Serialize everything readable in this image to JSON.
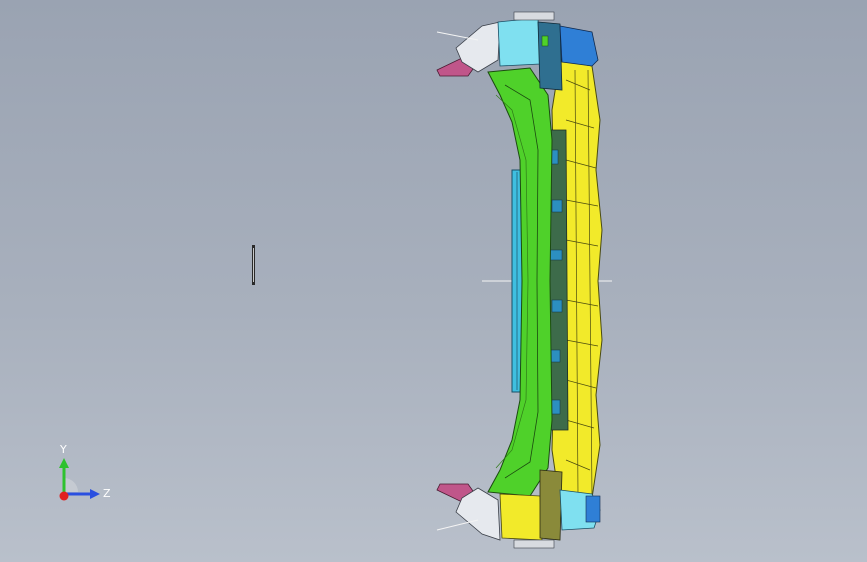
{
  "triad": {
    "y_label": "Y",
    "z_label": "Z",
    "colors": {
      "y": "#2ec22e",
      "z": "#2a4fe0",
      "x": "#e02020"
    }
  },
  "colors": {
    "background_top": "#9aa3b2",
    "background_bottom": "#b9c0cb",
    "frame_green": "#4fd12a",
    "bumper_yellow": "#f2ea2a",
    "bracket_cyan": "#7fe0f0",
    "bracket_blue": "#2f7fd6",
    "mount_magenta": "#c0568a",
    "rail_cyan": "#3fbfe0"
  }
}
